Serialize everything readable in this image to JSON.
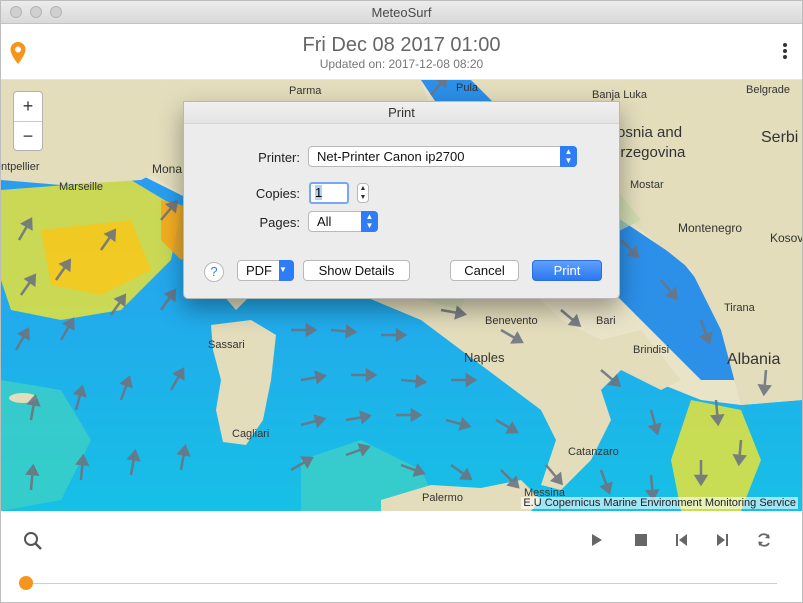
{
  "window": {
    "title": "MeteoSurf"
  },
  "header": {
    "forecast_time": "Fri Dec 08 2017 01:00",
    "updated": "Updated on: 2017-12-08 08:20"
  },
  "map": {
    "zoom_in": "+",
    "zoom_out": "−",
    "attribution": "E.U Copernicus Marine Environment Monitoring Service",
    "cities": [
      "Parma",
      "Pula",
      "Banja Luka",
      "Belgrade",
      "ntpellier",
      "Marseille",
      "Mona",
      "Mostar",
      "Montenegro",
      "Kosov",
      "Tirana",
      "Benevento",
      "Bari",
      "Sassari",
      "Naples",
      "Brindisi",
      "Cagliari",
      "Catanzaro",
      "Palermo",
      "Messina"
    ],
    "countries": [
      "osnia and",
      "erzegovina",
      "Serbi",
      "Albania"
    ]
  },
  "print_dialog": {
    "title": "Print",
    "printer_label": "Printer:",
    "printer_value": "Net-Printer Canon ip2700",
    "copies_label": "Copies:",
    "copies_value": "1",
    "pages_label": "Pages:",
    "pages_value": "All",
    "help": "?",
    "pdf": "PDF",
    "show_details": "Show Details",
    "cancel": "Cancel",
    "print": "Print"
  },
  "controls": {
    "timeline_position": 0
  },
  "colors": {
    "accent_orange": "#f7941d",
    "primary_blue": "#2e7cf6"
  }
}
